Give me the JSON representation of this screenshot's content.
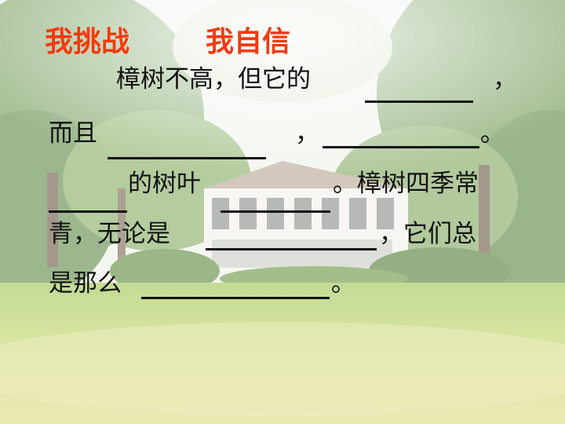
{
  "header": {
    "title_left": "我挑战",
    "title_right": "我自信"
  },
  "exercise": {
    "line1_text": "樟树不高，但它的",
    "line1_end": "，",
    "line2_start": "而且",
    "line2_mid": "，",
    "line2_end": "。",
    "line3_text": "的树叶",
    "line3_mid": "。樟树四季常",
    "line5_start": "青，无论是",
    "line5_mid": "，它们总",
    "line6_start": "是那么",
    "line6_end": "。"
  },
  "colors": {
    "title": "#f23a0e",
    "text": "#111111"
  }
}
